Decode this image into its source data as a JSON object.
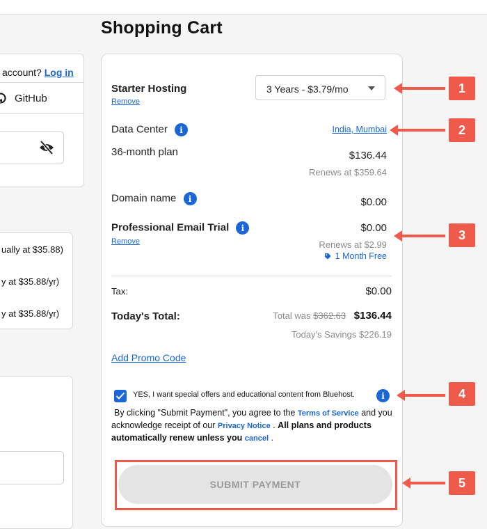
{
  "page": {
    "title": "Shopping Cart"
  },
  "left": {
    "account_prompt": "account?",
    "login_link": "Log in",
    "github_label": "GitHub",
    "options": [
      "ually at $35.88)",
      "y at $35.88/yr)",
      "y at $35.88/yr)"
    ]
  },
  "cart": {
    "product": {
      "name": "Starter Hosting",
      "remove": "Remove",
      "term_selected": "3 Years - $3.79/mo"
    },
    "data_center": {
      "label": "Data Center",
      "value": "India, Mumbai"
    },
    "plan": {
      "label": "36-month plan",
      "price": "$136.44",
      "renews": "Renews at $359.64"
    },
    "domain": {
      "label": "Domain name",
      "price": "$0.00"
    },
    "email": {
      "label": "Professional Email Trial",
      "remove": "Remove",
      "price": "$0.00",
      "renews": "Renews at $2.99",
      "promo": "1 Month Free"
    },
    "tax": {
      "label": "Tax:",
      "value": "$0.00"
    },
    "total": {
      "label": "Today's Total:",
      "was_prefix": "Total was",
      "was_value": "$362.63",
      "value": "$136.44",
      "savings": "Today's Savings $226.19"
    },
    "promo_link": "Add Promo Code",
    "offers_checkbox": {
      "label": "YES, I want special offers and educational content from Bluehost.",
      "checked": true
    },
    "legal": {
      "part1": "By clicking \"Submit Payment\", you agree to the",
      "tos": "Terms of Service",
      "part2": "and you acknowledge receipt of our",
      "privacy": "Privacy Notice",
      "part3": ".",
      "bold": "All plans and products automatically renew unless you",
      "cancel": "cancel",
      "part4": "."
    },
    "submit_label": "SUBMIT PAYMENT"
  },
  "annotations": [
    "1",
    "2",
    "3",
    "4",
    "5"
  ],
  "colors": {
    "accent": "#1a66d6",
    "annotation": "#ef5a4a",
    "disabled_button": "#e4e4e4"
  }
}
